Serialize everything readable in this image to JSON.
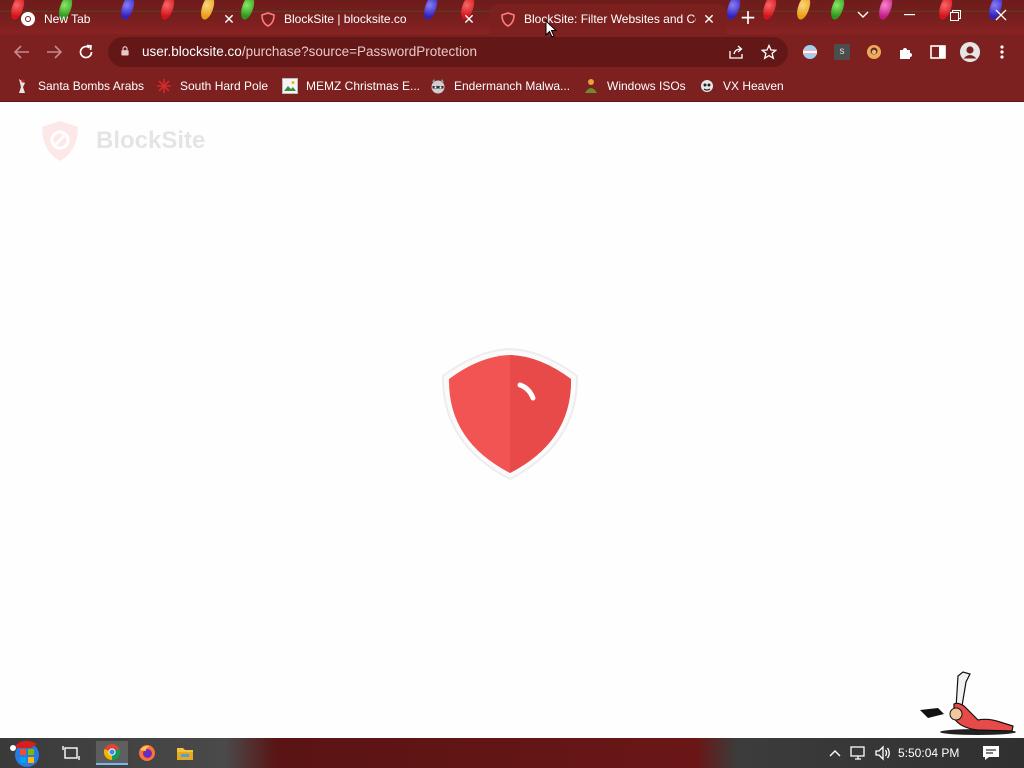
{
  "browser": {
    "tabs": [
      {
        "title": "New Tab",
        "favicon": "chrome-icon",
        "active": false
      },
      {
        "title": "BlockSite | blocksite.co",
        "favicon": "blocksite-shield-icon",
        "active": false
      },
      {
        "title": "BlockSite: Filter Websites and Co",
        "favicon": "blocksite-shield-icon",
        "active": true
      }
    ],
    "new_tab_symbol": "+",
    "url": {
      "host": "user.blocksite.co",
      "path": "/purchase?source=PasswordProtection"
    },
    "profile_extension_letter": "s"
  },
  "bookmarks": [
    {
      "label": "Santa Bombs Arabs",
      "icon": "santa-icon"
    },
    {
      "label": "South Hard Pole",
      "icon": "snowflake-icon"
    },
    {
      "label": "MEMZ Christmas E...",
      "icon": "image-icon"
    },
    {
      "label": "Endermanch Malwa...",
      "icon": "raccoon-icon"
    },
    {
      "label": "Windows ISOs",
      "icon": "person-icon"
    },
    {
      "label": "VX Heaven",
      "icon": "virus-icon"
    }
  ],
  "page": {
    "brand": "BlockSite",
    "status": "loading"
  },
  "taskbar": {
    "clock": "5:50:04 PM"
  },
  "colors": {
    "frame": "#7d2020",
    "omnibox": "#631717",
    "shield": "#f25454"
  }
}
